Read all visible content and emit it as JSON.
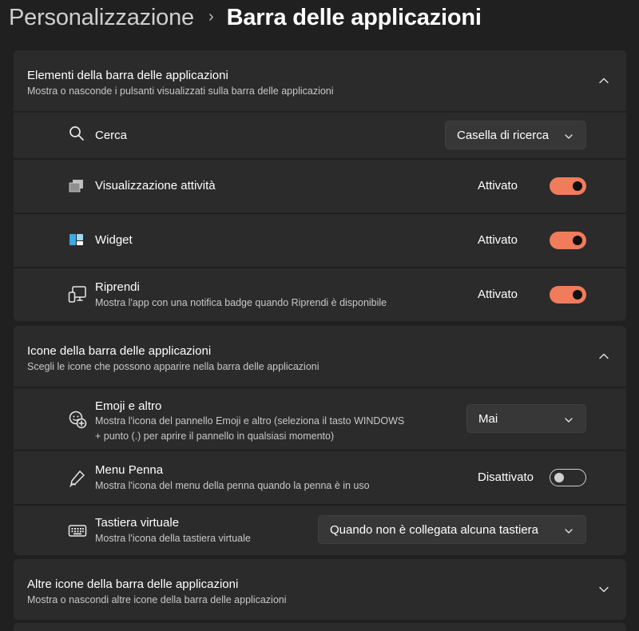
{
  "breadcrumb": {
    "parent": "Personalizzazione",
    "separator": "›",
    "current": "Barra delle applicazioni"
  },
  "sections": [
    {
      "title": "Elementi della barra delle applicazioni",
      "subtitle": "Mostra o nasconde i pulsanti visualizzati sulla barra delle applicazioni",
      "expanded": true,
      "items": [
        {
          "icon": "search-icon",
          "title": "Cerca",
          "control": "dropdown",
          "value": "Casella di ricerca"
        },
        {
          "icon": "task-view-icon",
          "title": "Visualizzazione attività",
          "control": "toggle",
          "state": "Attivato",
          "on": true
        },
        {
          "icon": "widgets-icon",
          "title": "Widget",
          "control": "toggle",
          "state": "Attivato",
          "on": true
        },
        {
          "icon": "resume-icon",
          "title": "Riprendi",
          "subtitle": "Mostra l'app con una notifica badge quando Riprendi è disponibile",
          "control": "toggle",
          "state": "Attivato",
          "on": true
        }
      ]
    },
    {
      "title": "Icone della barra delle applicazioni",
      "subtitle": "Scegli le icone che possono apparire nella barra delle applicazioni",
      "expanded": true,
      "items": [
        {
          "icon": "emoji-icon",
          "title": "Emoji e altro",
          "subtitle_line1": "Mostra l'icona del pannello Emoji e altro (seleziona il tasto WINDOWS",
          "subtitle_line2": "+ punto (.) per aprire il pannello in qualsiasi momento)",
          "control": "dropdown",
          "value": "Mai"
        },
        {
          "icon": "pen-icon",
          "title": "Menu Penna",
          "subtitle": "Mostra l'icona del menu della penna quando la penna è in uso",
          "control": "toggle",
          "state": "Disattivato",
          "on": false
        },
        {
          "icon": "keyboard-icon",
          "title": "Tastiera virtuale",
          "subtitle": "Mostra l'icona della tastiera virtuale",
          "control": "dropdown",
          "value": "Quando non è collegata alcuna tastiera"
        }
      ]
    },
    {
      "title": "Altre icone della barra delle applicazioni",
      "subtitle": "Mostra o nascondi altre icone della barra delle applicazioni",
      "expanded": false
    }
  ],
  "colors": {
    "background": "#202020",
    "card": "#2b2b2b",
    "accent": "#f07c5c"
  }
}
